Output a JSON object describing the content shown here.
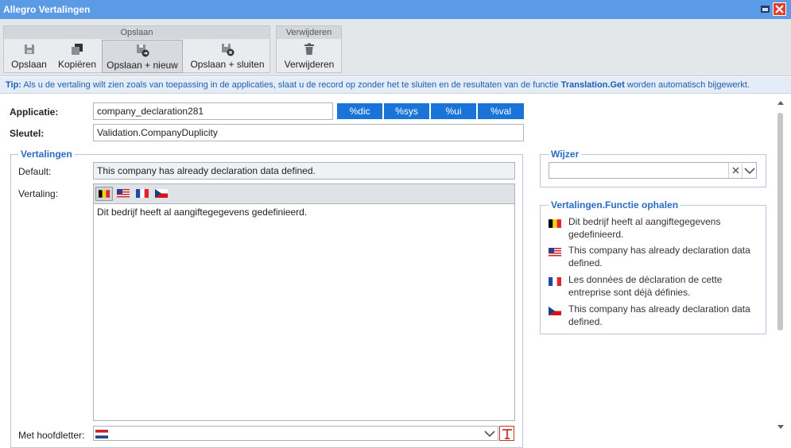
{
  "window": {
    "title": "Allegro Vertalingen"
  },
  "ribbon": {
    "group_save": {
      "label": "Opslaan",
      "buttons": [
        "Opslaan",
        "Kopiëren",
        "Opslaan + nieuw",
        "Opslaan + sluiten"
      ]
    },
    "group_delete": {
      "label": "Verwijderen",
      "buttons": [
        "Verwijderen"
      ]
    }
  },
  "tip": {
    "prefix": "Tip:",
    "text1": "Als u de vertaling wilt zien zoals van toepassing in de applicaties, slaat u de record op zonder het te sluiten en de resultaten van de functie",
    "fn": "Translation.Get",
    "text2": "worden automatisch bijgewerkt."
  },
  "form": {
    "applicatie": {
      "label": "Applicatie:",
      "value": "company_declaration281"
    },
    "tags": [
      "%dic",
      "%sys",
      "%ui",
      "%val"
    ],
    "sleutel": {
      "label": "Sleutel:",
      "value": "Validation.CompanyDuplicity"
    }
  },
  "vertalingen": {
    "legend": "Vertalingen",
    "default_label": "Default:",
    "default_value": "This company has already declaration data defined.",
    "vertaling_label": "Vertaling:",
    "flags": [
      "belgium-flag-icon",
      "usa-flag-icon",
      "france-flag-icon",
      "czech-flag-icon"
    ],
    "vertaling_value": "Dit bedrijf heeft al aangiftegegevens gedefinieerd.",
    "hoofdletter_label": "Met hoofdletter:"
  },
  "wijzer": {
    "legend": "Wijzer",
    "value": ""
  },
  "functie": {
    "legend": "Vertalingen.Functie ophalen",
    "items": [
      {
        "flag": "belgium-flag-icon",
        "text": "Dit bedrijf heeft al aangiftegegevens gedefinieerd."
      },
      {
        "flag": "usa-flag-icon",
        "text": "This company has already declaration data defined."
      },
      {
        "flag": "france-flag-icon",
        "text": "Les données de déclaration de cette entreprise sont déjà définies."
      },
      {
        "flag": "czech-flag-icon",
        "text": "This company has already declaration data defined."
      }
    ]
  },
  "colors": {
    "titlebar": "#5b9be6",
    "accent": "#1a73d6",
    "legend": "#2a6cc4",
    "close": "#e53c2a"
  }
}
